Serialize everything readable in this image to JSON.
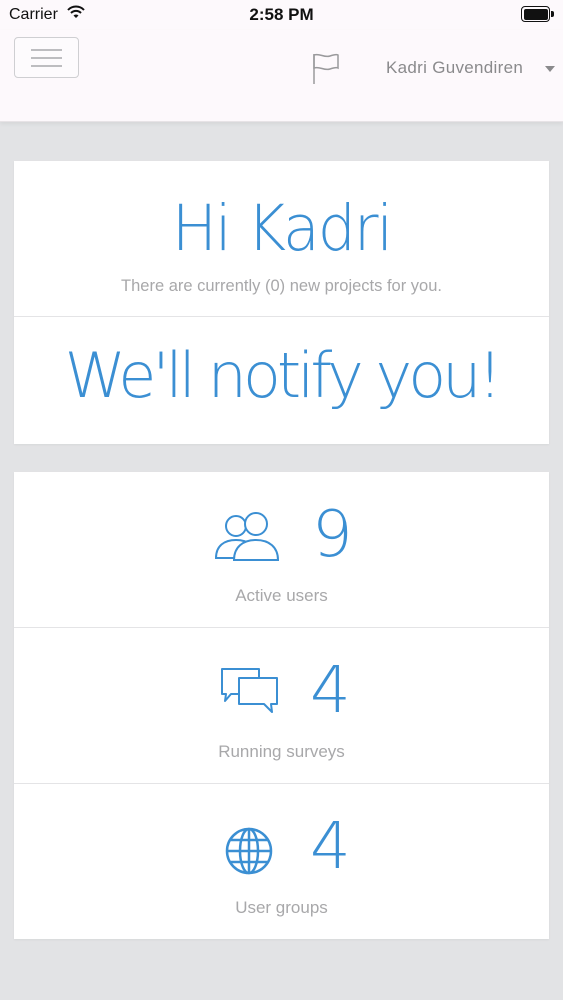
{
  "status_bar": {
    "carrier": "Carrier",
    "time": "2:58 PM",
    "wifi_icon": "wifi-icon",
    "battery_icon": "battery-icon"
  },
  "nav": {
    "menu_icon": "hamburger-menu-icon",
    "flag_icon": "flag-icon",
    "user_name": "Kadri Guvendiren",
    "caret_icon": "caret-down-icon"
  },
  "welcome": {
    "greeting": "Hi Kadri",
    "subtext": "There are currently (0) new projects for you.",
    "notify": "We'll notify you!"
  },
  "stats": [
    {
      "icon": "users-icon",
      "value": "9",
      "label": "Active users"
    },
    {
      "icon": "chat-bubbles-icon",
      "value": "4",
      "label": "Running surveys"
    },
    {
      "icon": "globe-icon",
      "value": "4",
      "label": "User groups"
    }
  ],
  "colors": {
    "accent": "#3b8fd3",
    "muted_text": "#a8a8aa",
    "background": "#e2e3e5"
  }
}
